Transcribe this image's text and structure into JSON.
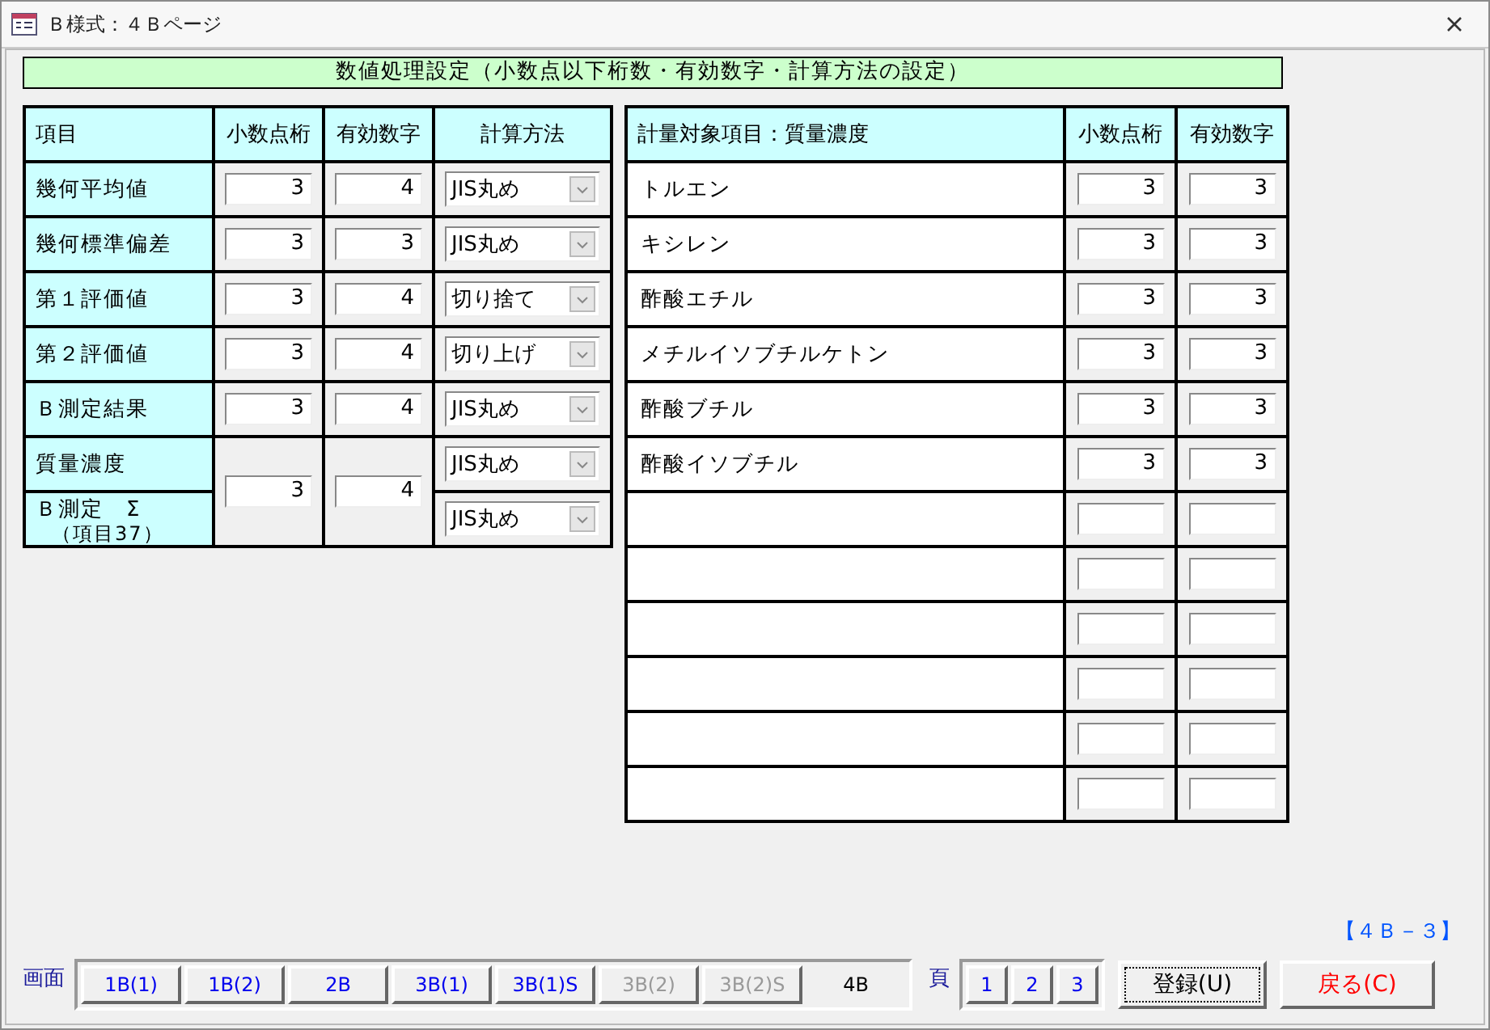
{
  "window": {
    "title": "Ｂ様式：４Ｂページ"
  },
  "header": "数値処理設定（小数点以下桁数・有効数字・計算方法の設定）",
  "left_table": {
    "columns": [
      "項目",
      "小数点桁",
      "有効数字",
      "計算方法"
    ],
    "rows": [
      {
        "label": "幾何平均値",
        "decimals": "3",
        "significant": "4",
        "method": "JIS丸め"
      },
      {
        "label": "幾何標準偏差",
        "decimals": "3",
        "significant": "3",
        "method": "JIS丸め"
      },
      {
        "label": "第１評価値",
        "decimals": "3",
        "significant": "4",
        "method": "切り捨て"
      },
      {
        "label": "第２評価値",
        "decimals": "3",
        "significant": "4",
        "method": "切り上げ"
      },
      {
        "label": "Ｂ測定結果",
        "decimals": "3",
        "significant": "4",
        "method": "JIS丸め"
      }
    ],
    "shared": {
      "decimals": "3",
      "significant": "4",
      "items": [
        {
          "lines": [
            "質量濃度"
          ],
          "method": "JIS丸め"
        },
        {
          "lines": [
            "Ｂ測定　Σ",
            "（項目37）"
          ],
          "method": "JIS丸め"
        }
      ]
    }
  },
  "right_table": {
    "columns": [
      "計量対象項目：質量濃度",
      "小数点桁",
      "有効数字"
    ],
    "rows": [
      {
        "kind": "item",
        "name": "トルエン",
        "decimals": "3",
        "significant": "3"
      },
      {
        "kind": "item",
        "name": "キシレン",
        "decimals": "3",
        "significant": "3"
      },
      {
        "kind": "item",
        "name": "酢酸エチル",
        "decimals": "3",
        "significant": "3"
      },
      {
        "kind": "item",
        "name": "メチルイソブチルケトン",
        "decimals": "3",
        "significant": "3"
      },
      {
        "kind": "item",
        "name": "酢酸ブチル",
        "decimals": "3",
        "significant": "3"
      },
      {
        "kind": "item",
        "name": "酢酸イソブチル",
        "decimals": "3",
        "significant": "3"
      },
      {
        "kind": "blank"
      },
      {
        "kind": "blank"
      },
      {
        "kind": "blank"
      },
      {
        "kind": "blank"
      },
      {
        "kind": "blank"
      },
      {
        "kind": "blank"
      }
    ]
  },
  "page_indicator": "【４Ｂ－３】",
  "footer": {
    "screen_label": "画面",
    "screens": [
      {
        "label": "1B(1)",
        "disabled": false,
        "selected": false
      },
      {
        "label": "1B(2)",
        "disabled": false,
        "selected": false
      },
      {
        "label": "2B",
        "disabled": false,
        "selected": false
      },
      {
        "label": "3B(1)",
        "disabled": false,
        "selected": false
      },
      {
        "label": "3B(1)S",
        "disabled": false,
        "selected": false
      },
      {
        "label": "3B(2)",
        "disabled": true,
        "selected": false
      },
      {
        "label": "3B(2)S",
        "disabled": true,
        "selected": false
      },
      {
        "label": "4B",
        "disabled": false,
        "selected": true
      }
    ],
    "page_label": "頁",
    "pages": [
      "1",
      "2",
      "3"
    ],
    "register": "登録(U)",
    "back": "戻る(C)"
  }
}
